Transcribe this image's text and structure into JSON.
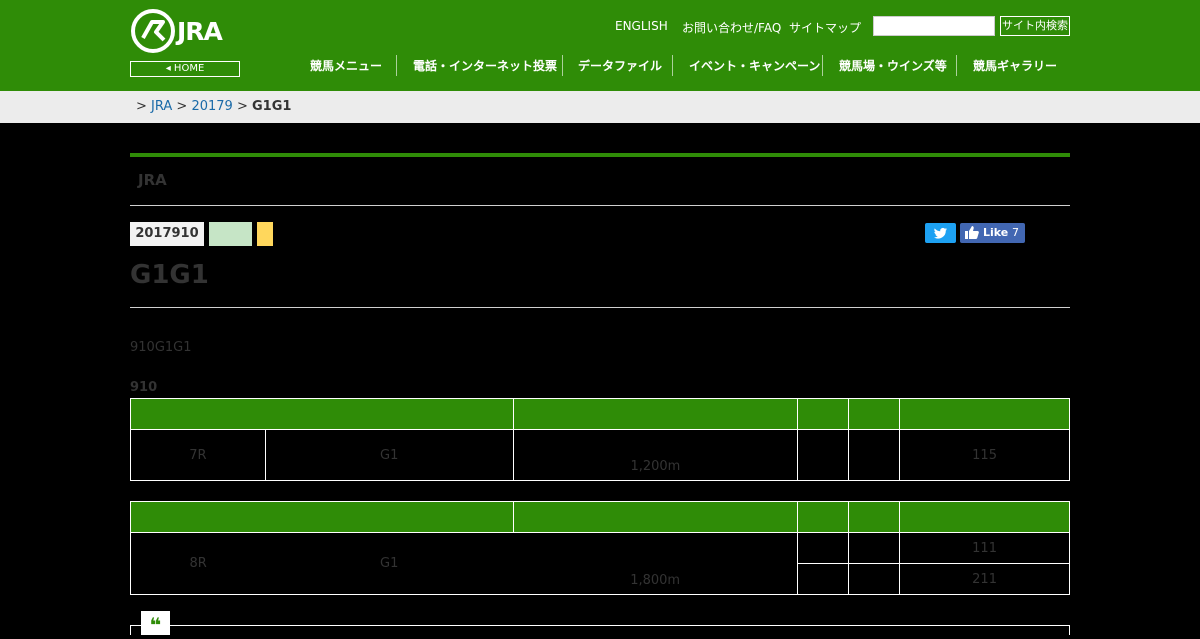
{
  "header": {
    "logo_text": "JRA",
    "home_label": "HOME",
    "util_links": [
      "ENGLISH",
      "お問い合わせ/FAQ",
      "サイトマップ"
    ],
    "search_placeholder": "",
    "search_button": "サイト内検索",
    "nav": [
      "競馬メニュー",
      "電話・インターネット投票",
      "データファイル",
      "イベント・キャンペーン",
      "競馬場・ウインズ等",
      "競馬ギャラリー"
    ],
    "brand_color": "#2f8c07"
  },
  "breadcrumb": {
    "sep": ">",
    "items": [
      "JRA",
      "20179"
    ],
    "current": "G1G1"
  },
  "content": {
    "section_title": "JRA",
    "date_tag": "2017910",
    "like_label": "Like",
    "like_count": "7",
    "page_title": "G1G1",
    "lead": "910G1G1",
    "subheading": "910",
    "race1": {
      "race": "7R",
      "grade": "G1",
      "distance": "1,200m",
      "col6": "115"
    },
    "race2": {
      "race": "8R",
      "grade": "G1",
      "distance": "1,800m",
      "col6a": "111",
      "col6b": "211"
    },
    "quote_icon": "❝"
  }
}
